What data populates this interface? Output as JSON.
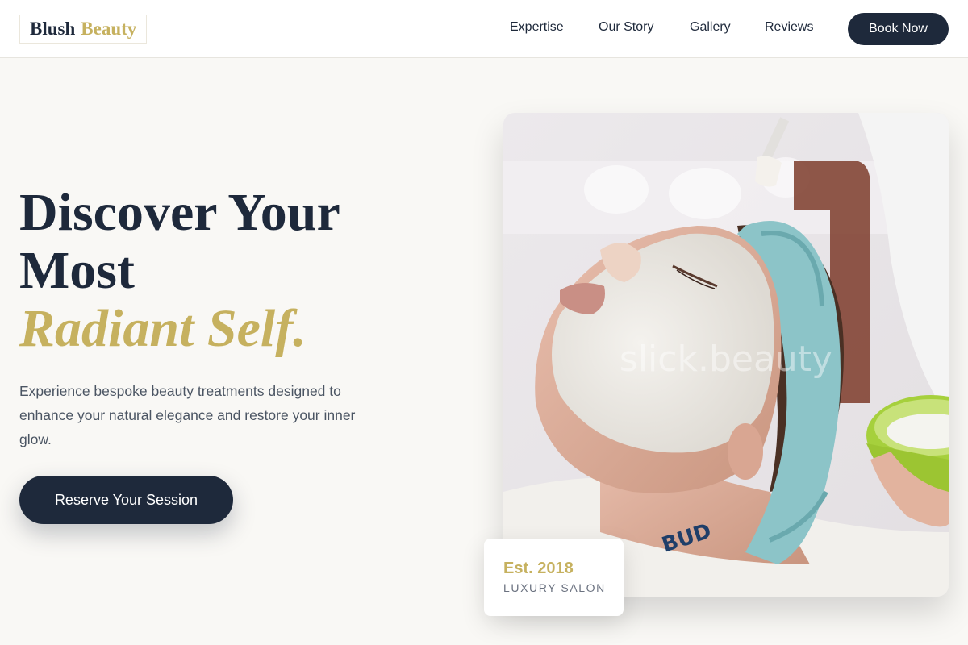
{
  "brand": {
    "name_part1": "Blush",
    "name_part2": "Beauty"
  },
  "nav": {
    "items": [
      "Expertise",
      "Our Story",
      "Gallery",
      "Reviews"
    ],
    "book_label": "Book Now"
  },
  "hero": {
    "title_line1": "Discover Your",
    "title_line2": "Most",
    "title_accent": "Radiant Self.",
    "description": "Experience bespoke beauty treatments designed to enhance your natural elegance and restore your inner glow.",
    "cta_label": "Reserve Your Session",
    "image_watermark": "slick.beauty"
  },
  "badge": {
    "est": "Est. 2018",
    "label": "LUXURY SALON"
  },
  "colors": {
    "navy": "#1e293b",
    "gold": "#c6b15f",
    "background": "#f9f8f5"
  }
}
